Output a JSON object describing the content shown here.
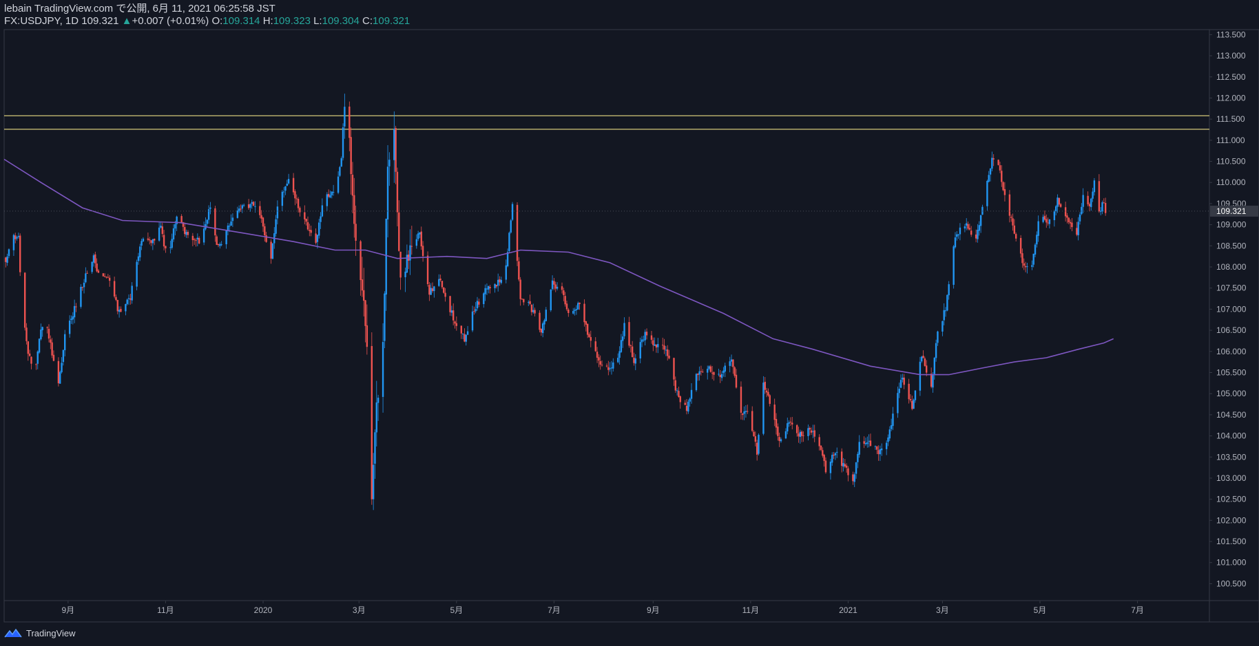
{
  "header": {
    "publish_line": "lebain TradingView.com で公開, 6月 11, 2021 06:25:58 JST",
    "symbol_prefix": "FX:USDJPY, 1D 109.321",
    "change_arrow": "▲",
    "change": "+0.007 (+0.01%)",
    "open_label": "O:",
    "open": "109.314",
    "high_label": "H:",
    "high": "109.323",
    "low_label": "L:",
    "low": "109.304",
    "close_label": "C:",
    "close": "109.321"
  },
  "footer": {
    "brand": "TradingView"
  },
  "colors": {
    "background": "#131722",
    "up": "#2196f3",
    "down": "#ef5350",
    "ma": "#7e57c2",
    "resistance": "#d4c97a",
    "axis_text": "#b2b5be",
    "grid_border": "#363a45",
    "last_price_tag": "#363a45"
  },
  "chart_data": {
    "type": "candlestick",
    "symbol": "FX:USDJPY",
    "interval": "1D",
    "last_price": 109.321,
    "ylim": [
      100.1,
      113.62
    ],
    "y_ticks": [
      100.5,
      101,
      101.5,
      102,
      102.5,
      103,
      103.5,
      104,
      104.5,
      105,
      105.5,
      106,
      106.5,
      107,
      107.5,
      108,
      108.5,
      109,
      109.5,
      110,
      110.5,
      111,
      111.5,
      112,
      112.5,
      113,
      113.5
    ],
    "x_range": [
      "2019-07-23",
      "2021-08-15"
    ],
    "x_ticks": [
      {
        "label": "9月",
        "date": "2019-09-01"
      },
      {
        "label": "11月",
        "date": "2019-11-01"
      },
      {
        "label": "2020",
        "date": "2020-01-01"
      },
      {
        "label": "3月",
        "date": "2020-03-01"
      },
      {
        "label": "5月",
        "date": "2020-05-01"
      },
      {
        "label": "7月",
        "date": "2020-07-01"
      },
      {
        "label": "9月",
        "date": "2020-09-01"
      },
      {
        "label": "11月",
        "date": "2020-11-01"
      },
      {
        "label": "2021",
        "date": "2021-01-01"
      },
      {
        "label": "3月",
        "date": "2021-03-01"
      },
      {
        "label": "5月",
        "date": "2021-05-01"
      },
      {
        "label": "7月",
        "date": "2021-07-01"
      }
    ],
    "horizontal_lines": [
      111.58,
      111.26
    ],
    "price_path": [
      [
        "2019-07-24",
        108.2
      ],
      [
        "2019-07-28",
        108.7
      ],
      [
        "2019-08-01",
        108.7
      ],
      [
        "2019-08-03",
        107.0
      ],
      [
        "2019-08-07",
        106.0
      ],
      [
        "2019-08-11",
        105.4
      ],
      [
        "2019-08-15",
        106.5
      ],
      [
        "2019-08-19",
        106.5
      ],
      [
        "2019-08-23",
        105.8
      ],
      [
        "2019-08-26",
        105.2
      ],
      [
        "2019-08-30",
        106.4
      ],
      [
        "2019-09-05",
        107.0
      ],
      [
        "2019-09-12",
        107.8
      ],
      [
        "2019-09-17",
        108.2
      ],
      [
        "2019-09-21",
        107.7
      ],
      [
        "2019-09-26",
        107.8
      ],
      [
        "2019-10-03",
        106.9
      ],
      [
        "2019-10-10",
        107.3
      ],
      [
        "2019-10-17",
        108.6
      ],
      [
        "2019-10-23",
        108.6
      ],
      [
        "2019-10-29",
        108.9
      ],
      [
        "2019-11-02",
        108.2
      ],
      [
        "2019-11-08",
        109.2
      ],
      [
        "2019-11-15",
        108.7
      ],
      [
        "2019-11-22",
        108.6
      ],
      [
        "2019-11-29",
        109.4
      ],
      [
        "2019-12-03",
        108.6
      ],
      [
        "2019-12-07",
        108.6
      ],
      [
        "2019-12-15",
        109.4
      ],
      [
        "2019-12-22",
        109.4
      ],
      [
        "2019-12-28",
        109.5
      ],
      [
        "2020-01-02",
        108.8
      ],
      [
        "2020-01-06",
        108.2
      ],
      [
        "2020-01-10",
        109.4
      ],
      [
        "2020-01-17",
        110.1
      ],
      [
        "2020-01-24",
        109.3
      ],
      [
        "2020-01-30",
        108.9
      ],
      [
        "2020-02-03",
        108.6
      ],
      [
        "2020-02-08",
        109.6
      ],
      [
        "2020-02-15",
        109.8
      ],
      [
        "2020-02-19",
        110.6
      ],
      [
        "2020-02-21",
        112.0
      ],
      [
        "2020-02-24",
        111.0
      ],
      [
        "2020-02-28",
        108.5
      ],
      [
        "2020-03-04",
        107.3
      ],
      [
        "2020-03-07",
        105.8
      ],
      [
        "2020-03-09",
        102.4
      ],
      [
        "2020-03-12",
        104.6
      ],
      [
        "2020-03-16",
        106.0
      ],
      [
        "2020-03-19",
        110.6
      ],
      [
        "2020-03-23",
        111.2
      ],
      [
        "2020-03-27",
        107.7
      ],
      [
        "2020-04-03",
        108.5
      ],
      [
        "2020-04-08",
        108.8
      ],
      [
        "2020-04-14",
        107.4
      ],
      [
        "2020-04-21",
        107.7
      ],
      [
        "2020-04-27",
        107.0
      ],
      [
        "2020-05-01",
        106.6
      ],
      [
        "2020-05-06",
        106.3
      ],
      [
        "2020-05-11",
        106.9
      ],
      [
        "2020-05-18",
        107.4
      ],
      [
        "2020-05-25",
        107.6
      ],
      [
        "2020-05-31",
        107.7
      ],
      [
        "2020-06-05",
        109.5
      ],
      [
        "2020-06-10",
        107.2
      ],
      [
        "2020-06-16",
        107.1
      ],
      [
        "2020-06-23",
        106.5
      ],
      [
        "2020-06-30",
        107.6
      ],
      [
        "2020-07-05",
        107.5
      ],
      [
        "2020-07-10",
        106.9
      ],
      [
        "2020-07-17",
        107.1
      ],
      [
        "2020-07-24",
        106.2
      ],
      [
        "2020-07-31",
        105.6
      ],
      [
        "2020-08-05",
        105.6
      ],
      [
        "2020-08-10",
        105.9
      ],
      [
        "2020-08-14",
        106.6
      ],
      [
        "2020-08-20",
        105.8
      ],
      [
        "2020-08-27",
        106.4
      ],
      [
        "2020-09-02",
        106.1
      ],
      [
        "2020-09-09",
        106.1
      ],
      [
        "2020-09-16",
        105.0
      ],
      [
        "2020-09-22",
        104.6
      ],
      [
        "2020-09-28",
        105.5
      ],
      [
        "2020-10-05",
        105.6
      ],
      [
        "2020-10-12",
        105.4
      ],
      [
        "2020-10-20",
        105.8
      ],
      [
        "2020-10-26",
        104.6
      ],
      [
        "2020-10-31",
        104.5
      ],
      [
        "2020-11-05",
        103.6
      ],
      [
        "2020-11-09",
        105.2
      ],
      [
        "2020-11-14",
        104.7
      ],
      [
        "2020-11-19",
        103.8
      ],
      [
        "2020-11-25",
        104.3
      ],
      [
        "2020-12-01",
        104.0
      ],
      [
        "2020-12-07",
        104.1
      ],
      [
        "2020-12-12",
        104.0
      ],
      [
        "2020-12-18",
        103.2
      ],
      [
        "2020-12-24",
        103.6
      ],
      [
        "2020-12-31",
        103.2
      ],
      [
        "2021-01-04",
        102.9
      ],
      [
        "2021-01-08",
        103.9
      ],
      [
        "2021-01-15",
        103.8
      ],
      [
        "2021-01-20",
        103.6
      ],
      [
        "2021-01-25",
        103.8
      ],
      [
        "2021-01-29",
        104.5
      ],
      [
        "2021-02-04",
        105.4
      ],
      [
        "2021-02-10",
        104.7
      ],
      [
        "2021-02-16",
        105.9
      ],
      [
        "2021-02-22",
        105.2
      ],
      [
        "2021-02-26",
        106.5
      ],
      [
        "2021-03-03",
        107.0
      ],
      [
        "2021-03-09",
        108.7
      ],
      [
        "2021-03-15",
        109.0
      ],
      [
        "2021-03-22",
        108.7
      ],
      [
        "2021-03-28",
        109.8
      ],
      [
        "2021-04-01",
        110.6
      ],
      [
        "2021-04-05",
        110.4
      ],
      [
        "2021-04-09",
        109.7
      ],
      [
        "2021-04-14",
        109.0
      ],
      [
        "2021-04-20",
        108.1
      ],
      [
        "2021-04-26",
        108.0
      ],
      [
        "2021-05-01",
        109.3
      ],
      [
        "2021-05-06",
        109.0
      ],
      [
        "2021-05-12",
        109.6
      ],
      [
        "2021-05-18",
        109.2
      ],
      [
        "2021-05-24",
        108.8
      ],
      [
        "2021-05-28",
        109.7
      ],
      [
        "2021-06-01",
        109.4
      ],
      [
        "2021-06-04",
        110.1
      ],
      [
        "2021-06-07",
        109.3
      ],
      [
        "2021-06-10",
        109.6
      ],
      [
        "2021-06-11",
        109.32
      ]
    ],
    "ma_line": [
      [
        "2019-07-23",
        110.55
      ],
      [
        "2019-08-15",
        110.0
      ],
      [
        "2019-09-10",
        109.4
      ],
      [
        "2019-10-05",
        109.1
      ],
      [
        "2019-11-10",
        109.05
      ],
      [
        "2019-12-20",
        108.8
      ],
      [
        "2020-01-20",
        108.6
      ],
      [
        "2020-02-15",
        108.4
      ],
      [
        "2020-03-05",
        108.4
      ],
      [
        "2020-03-25",
        108.2
      ],
      [
        "2020-04-25",
        108.25
      ],
      [
        "2020-05-20",
        108.2
      ],
      [
        "2020-06-10",
        108.4
      ],
      [
        "2020-07-10",
        108.35
      ],
      [
        "2020-08-05",
        108.1
      ],
      [
        "2020-09-05",
        107.55
      ],
      [
        "2020-10-15",
        106.9
      ],
      [
        "2020-11-15",
        106.3
      ],
      [
        "2020-12-10",
        106.05
      ],
      [
        "2021-01-15",
        105.65
      ],
      [
        "2021-02-15",
        105.45
      ],
      [
        "2021-03-05",
        105.45
      ],
      [
        "2021-03-25",
        105.6
      ],
      [
        "2021-04-15",
        105.75
      ],
      [
        "2021-05-05",
        105.85
      ],
      [
        "2021-05-25",
        106.05
      ],
      [
        "2021-06-10",
        106.2
      ],
      [
        "2021-06-16",
        106.3
      ]
    ]
  }
}
